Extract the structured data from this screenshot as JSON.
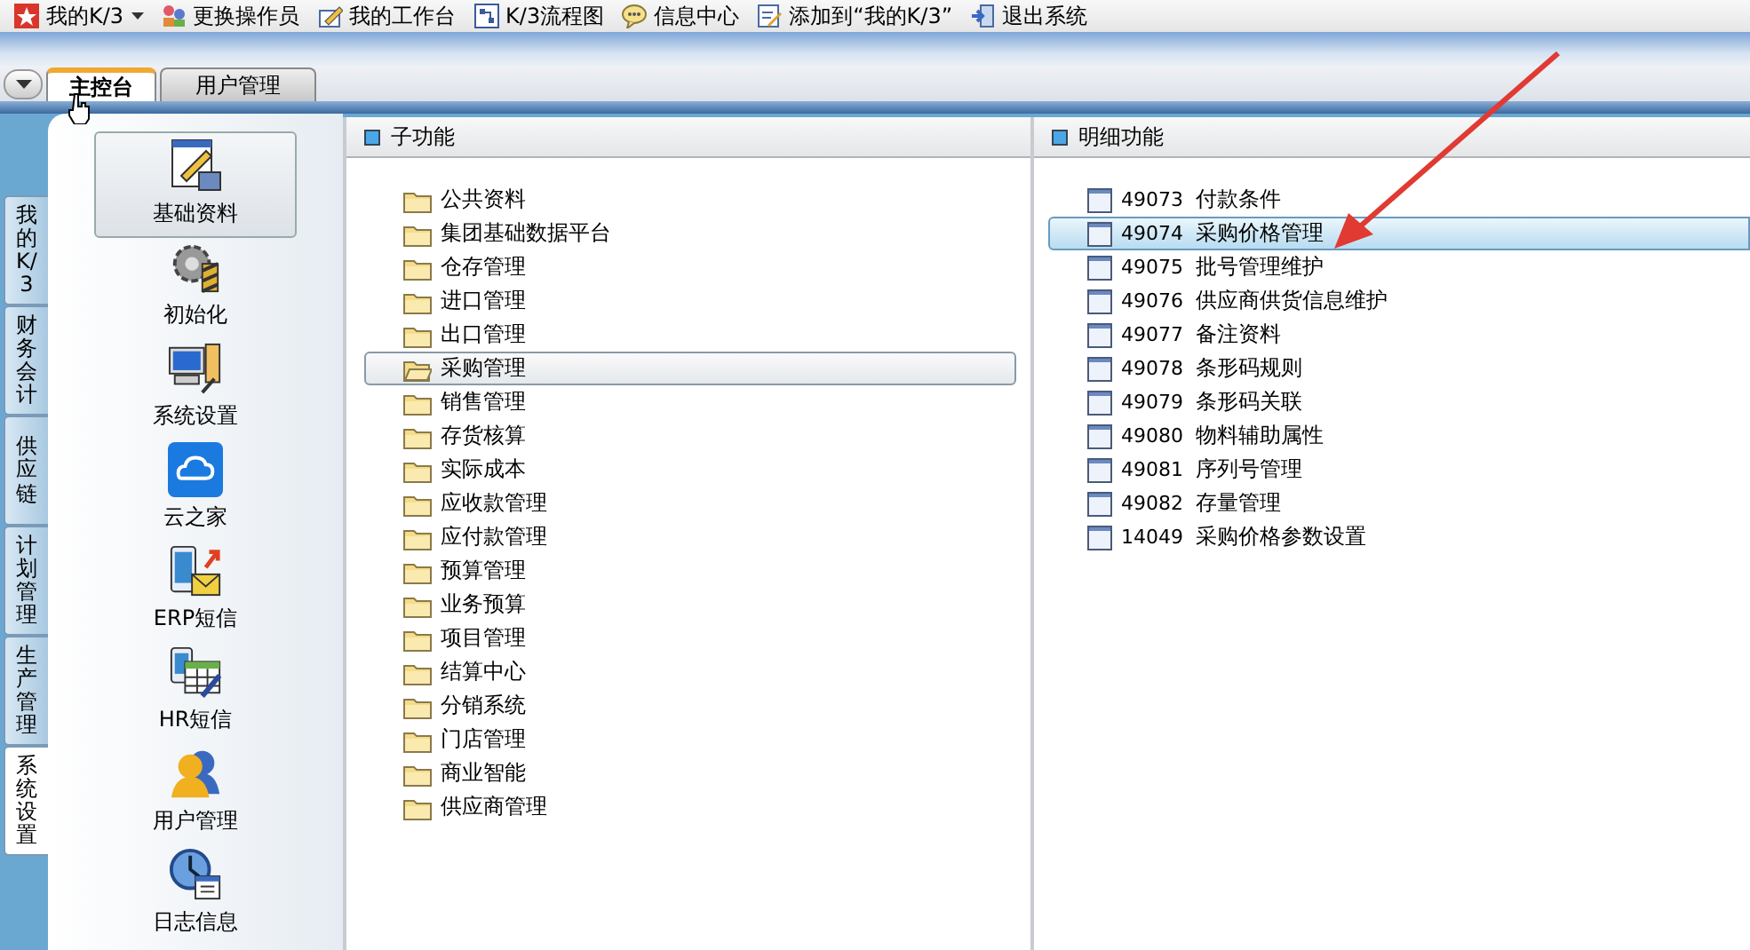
{
  "toolbar": [
    {
      "label": "我的K/3",
      "kind": "dropdown"
    },
    {
      "label": "更换操作员",
      "kind": "button"
    },
    {
      "label": "我的工作台",
      "kind": "button"
    },
    {
      "label": "K/3流程图",
      "kind": "button"
    },
    {
      "label": "信息中心",
      "kind": "button"
    },
    {
      "label": "添加到“我的K/3”",
      "kind": "button"
    },
    {
      "label": "退出系统",
      "kind": "button"
    }
  ],
  "tabs": [
    {
      "label": "主控台",
      "selected": true
    },
    {
      "label": "用户管理",
      "selected": false
    }
  ],
  "side_tabs": [
    {
      "label": "我的K/3",
      "selected": false
    },
    {
      "label": "财务会计",
      "selected": false
    },
    {
      "label": "供应链",
      "selected": false
    },
    {
      "label": "计划管理",
      "selected": false
    },
    {
      "label": "生产管理",
      "selected": false
    },
    {
      "label": "系统设置",
      "selected": true
    }
  ],
  "modules": [
    {
      "label": "基础资料",
      "selected": true
    },
    {
      "label": "初始化",
      "selected": false
    },
    {
      "label": "系统设置",
      "selected": false
    },
    {
      "label": "云之家",
      "selected": false
    },
    {
      "label": "ERP短信",
      "selected": false
    },
    {
      "label": "HR短信",
      "selected": false
    },
    {
      "label": "用户管理",
      "selected": false
    },
    {
      "label": "日志信息",
      "selected": false
    }
  ],
  "sub_panel": {
    "title": "子功能",
    "items": [
      {
        "label": "公共资料",
        "selected": false
      },
      {
        "label": "集团基础数据平台",
        "selected": false
      },
      {
        "label": "仓存管理",
        "selected": false
      },
      {
        "label": "进口管理",
        "selected": false
      },
      {
        "label": "出口管理",
        "selected": false
      },
      {
        "label": "采购管理",
        "selected": true
      },
      {
        "label": "销售管理",
        "selected": false
      },
      {
        "label": "存货核算",
        "selected": false
      },
      {
        "label": "实际成本",
        "selected": false
      },
      {
        "label": "应收款管理",
        "selected": false
      },
      {
        "label": "应付款管理",
        "selected": false
      },
      {
        "label": "预算管理",
        "selected": false
      },
      {
        "label": "业务预算",
        "selected": false
      },
      {
        "label": "项目管理",
        "selected": false
      },
      {
        "label": "结算中心",
        "selected": false
      },
      {
        "label": "分销系统",
        "selected": false
      },
      {
        "label": "门店管理",
        "selected": false
      },
      {
        "label": "商业智能",
        "selected": false
      },
      {
        "label": "供应商管理",
        "selected": false
      }
    ]
  },
  "detail_panel": {
    "title": "明细功能",
    "items": [
      {
        "code": "49073",
        "label": "付款条件",
        "selected": false
      },
      {
        "code": "49074",
        "label": "采购价格管理",
        "selected": true
      },
      {
        "code": "49075",
        "label": "批号管理维护",
        "selected": false
      },
      {
        "code": "49076",
        "label": "供应商供货信息维护",
        "selected": false
      },
      {
        "code": "49077",
        "label": "备注资料",
        "selected": false
      },
      {
        "code": "49078",
        "label": "条形码规则",
        "selected": false
      },
      {
        "code": "49079",
        "label": "条形码关联",
        "selected": false
      },
      {
        "code": "49080",
        "label": "物料辅助属性",
        "selected": false
      },
      {
        "code": "49081",
        "label": "序列号管理",
        "selected": false
      },
      {
        "code": "49082",
        "label": "存量管理",
        "selected": false
      },
      {
        "code": "14049",
        "label": "采购价格参数设置",
        "selected": false
      }
    ]
  }
}
